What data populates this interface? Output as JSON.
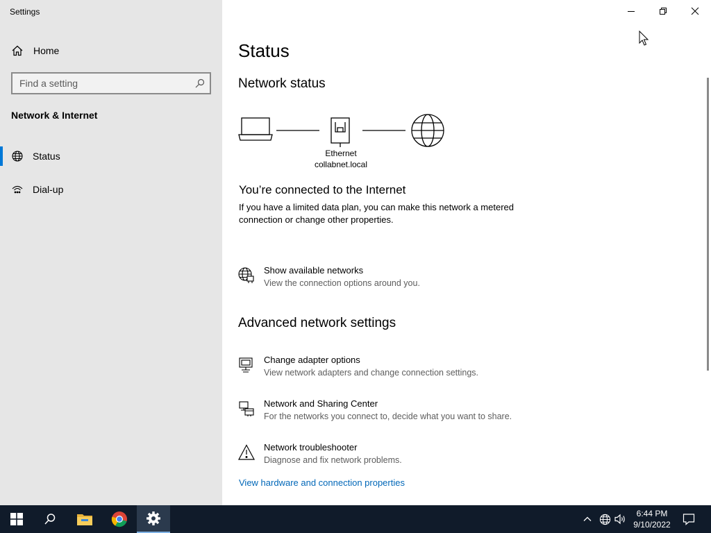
{
  "app": {
    "title": "Settings"
  },
  "sidebar": {
    "home_label": "Home",
    "search_placeholder": "Find a setting",
    "section_title": "Network & Internet",
    "items": [
      {
        "label": "Status",
        "icon": "globe-icon",
        "active": true
      },
      {
        "label": "Dial-up",
        "icon": "dial-up-icon",
        "active": false
      }
    ]
  },
  "main": {
    "title": "Status",
    "network_status_heading": "Network status",
    "diagram": {
      "adapter_label": "Ethernet",
      "network_label": "collabnet.local"
    },
    "connected_title": "You’re connected to the Internet",
    "connected_desc": "If you have a limited data plan, you can make this network a metered connection or change other properties.",
    "show_networks": {
      "title": "Show available networks",
      "desc": "View the connection options around you."
    },
    "advanced_heading": "Advanced network settings",
    "advanced_items": [
      {
        "title": "Change adapter options",
        "desc": "View network adapters and change connection settings.",
        "icon": "adapter-icon"
      },
      {
        "title": "Network and Sharing Center",
        "desc": "For the networks you connect to, decide what you want to share.",
        "icon": "sharing-center-icon"
      },
      {
        "title": "Network troubleshooter",
        "desc": "Diagnose and fix network problems.",
        "icon": "warning-icon"
      }
    ],
    "hardware_link": "View hardware and connection properties"
  },
  "taskbar": {
    "time": "6:44 PM",
    "date": "9/10/2022"
  },
  "colors": {
    "accent": "#0078d7",
    "link": "#0067b8",
    "sidebar_bg": "#e6e6e6",
    "taskbar_bg": "#101b2a"
  }
}
